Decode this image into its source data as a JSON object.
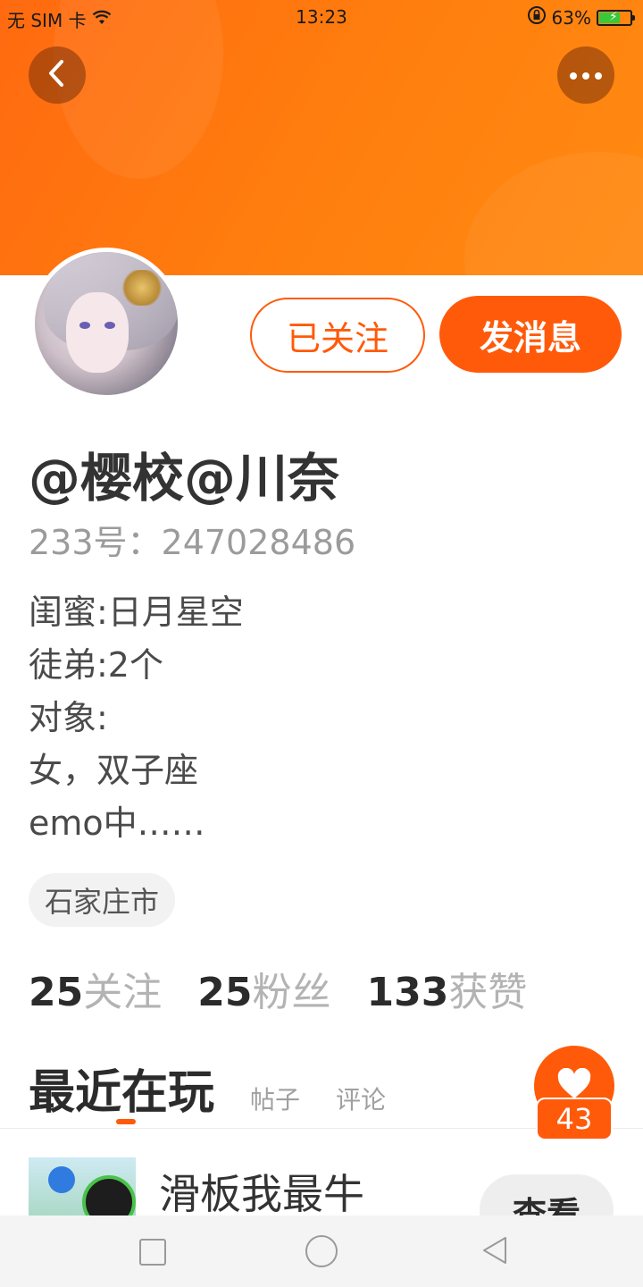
{
  "status_bar": {
    "carrier": "无 SIM 卡",
    "time": "13:23",
    "battery": "63%",
    "battery_level": 0.63,
    "icons": [
      "wifi-icon",
      "lock-rotation-icon",
      "battery-charging-icon"
    ]
  },
  "header": {
    "back_icon": "chevron-left-icon",
    "more_icon": "more-dots-icon",
    "accent_color": "#ff5a0a"
  },
  "profile": {
    "username": "@樱校@川奈",
    "uid": "233号：247028486",
    "bio_lines": [
      "闺蜜:日月星空",
      "徒弟:2个",
      "对象:",
      "女，双子座",
      "emo中……"
    ],
    "location": "石家庄市"
  },
  "actions": {
    "follow_label": "已关注",
    "message_label": "发消息"
  },
  "stats": [
    {
      "num": "25",
      "label": "关注"
    },
    {
      "num": "25",
      "label": "粉丝"
    },
    {
      "num": "133",
      "label": "获赞"
    }
  ],
  "tabs": {
    "active": "最近在玩",
    "items": [
      "帖子",
      "评论"
    ]
  },
  "like": {
    "count": "43"
  },
  "recent_game": {
    "title": "滑板我最牛",
    "view_label": "查看"
  }
}
